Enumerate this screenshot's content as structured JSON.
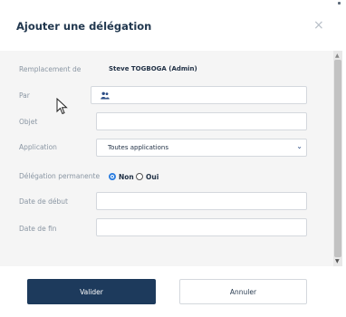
{
  "dialog": {
    "title": "Ajouter une délégation",
    "close_symbol": "×"
  },
  "form": {
    "remplacement_label": "Remplacement de",
    "remplacement_value": "Steve TOGBOGA (Admin)",
    "par_label": "Par",
    "par_value": "",
    "objet_label": "Objet",
    "objet_value": "",
    "application_label": "Application",
    "application_value": "Toutes applications",
    "permanente_label": "Délégation permanente",
    "radio_non": "Non",
    "radio_oui": "Oui",
    "radio_selected": "Non",
    "date_debut_label": "Date de début",
    "date_debut_value": "",
    "date_fin_label": "Date de fin",
    "date_fin_value": ""
  },
  "footer": {
    "validate_label": "Valider",
    "cancel_label": "Annuler"
  },
  "colors": {
    "primary": "#1d3a5c",
    "radio_accent": "#2e7fe0",
    "body_bg": "#f5f5f5"
  },
  "icons": {
    "par_field": "users-icon",
    "close": "close-icon",
    "select": "chevron-down-icon"
  }
}
